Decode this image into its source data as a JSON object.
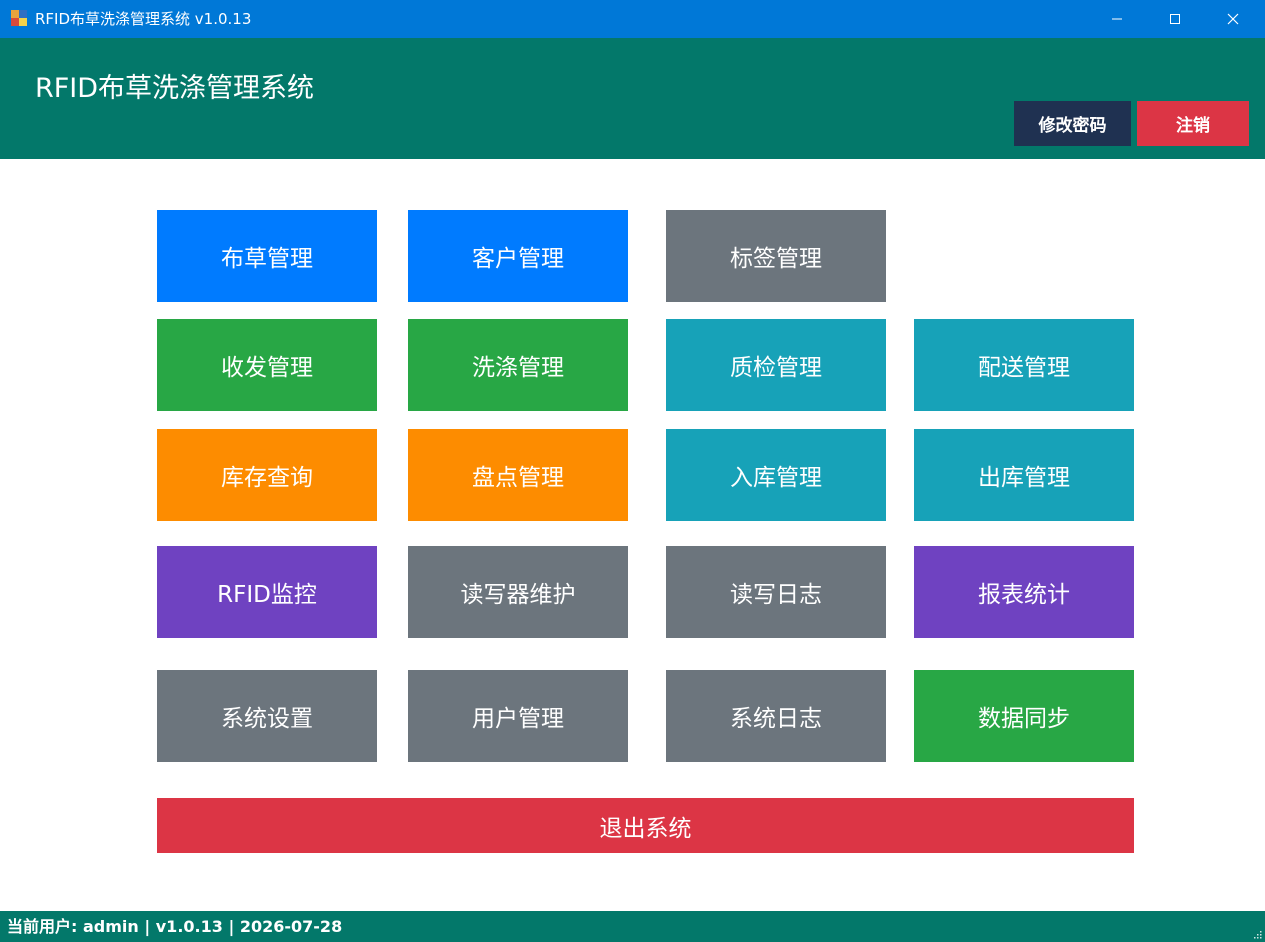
{
  "window": {
    "title": "RFID布草洗涤管理系统 v1.0.13",
    "icon": "app-icon",
    "controls": [
      "minimize-icon",
      "maximize-icon",
      "close-icon"
    ]
  },
  "header": {
    "title": "RFID布草洗涤管理系统",
    "change_password_label": "修改密码",
    "logout_label": "注销"
  },
  "tiles": {
    "linen": "布草管理",
    "customer": "客户管理",
    "tag": "标签管理",
    "shipping": "收发管理",
    "washing": "洗涤管理",
    "quality": "质检管理",
    "delivery": "配送管理",
    "inventory_query": "库存查询",
    "stocktake": "盘点管理",
    "inbound": "入库管理",
    "outbound": "出库管理",
    "rfid_monitor": "RFID监控",
    "reader_maintenance": "读写器维护",
    "rw_log": "读写日志",
    "reports": "报表统计",
    "system_settings": "系统设置",
    "user_management": "用户管理",
    "system_log": "系统日志",
    "data_sync": "数据同步"
  },
  "exit_label": "退出系统",
  "status": {
    "text": "当前用户: admin | v1.0.13 | 2026-07-28"
  },
  "colors": {
    "titlebar": "#0078d7",
    "header": "#03786a",
    "blue": "#007bff",
    "gray": "#6c757d",
    "green": "#28a745",
    "teal": "#17a2b8",
    "orange": "#fd8c00",
    "purple": "#6f42c1",
    "red": "#dc3545",
    "navy": "#1f3151"
  }
}
